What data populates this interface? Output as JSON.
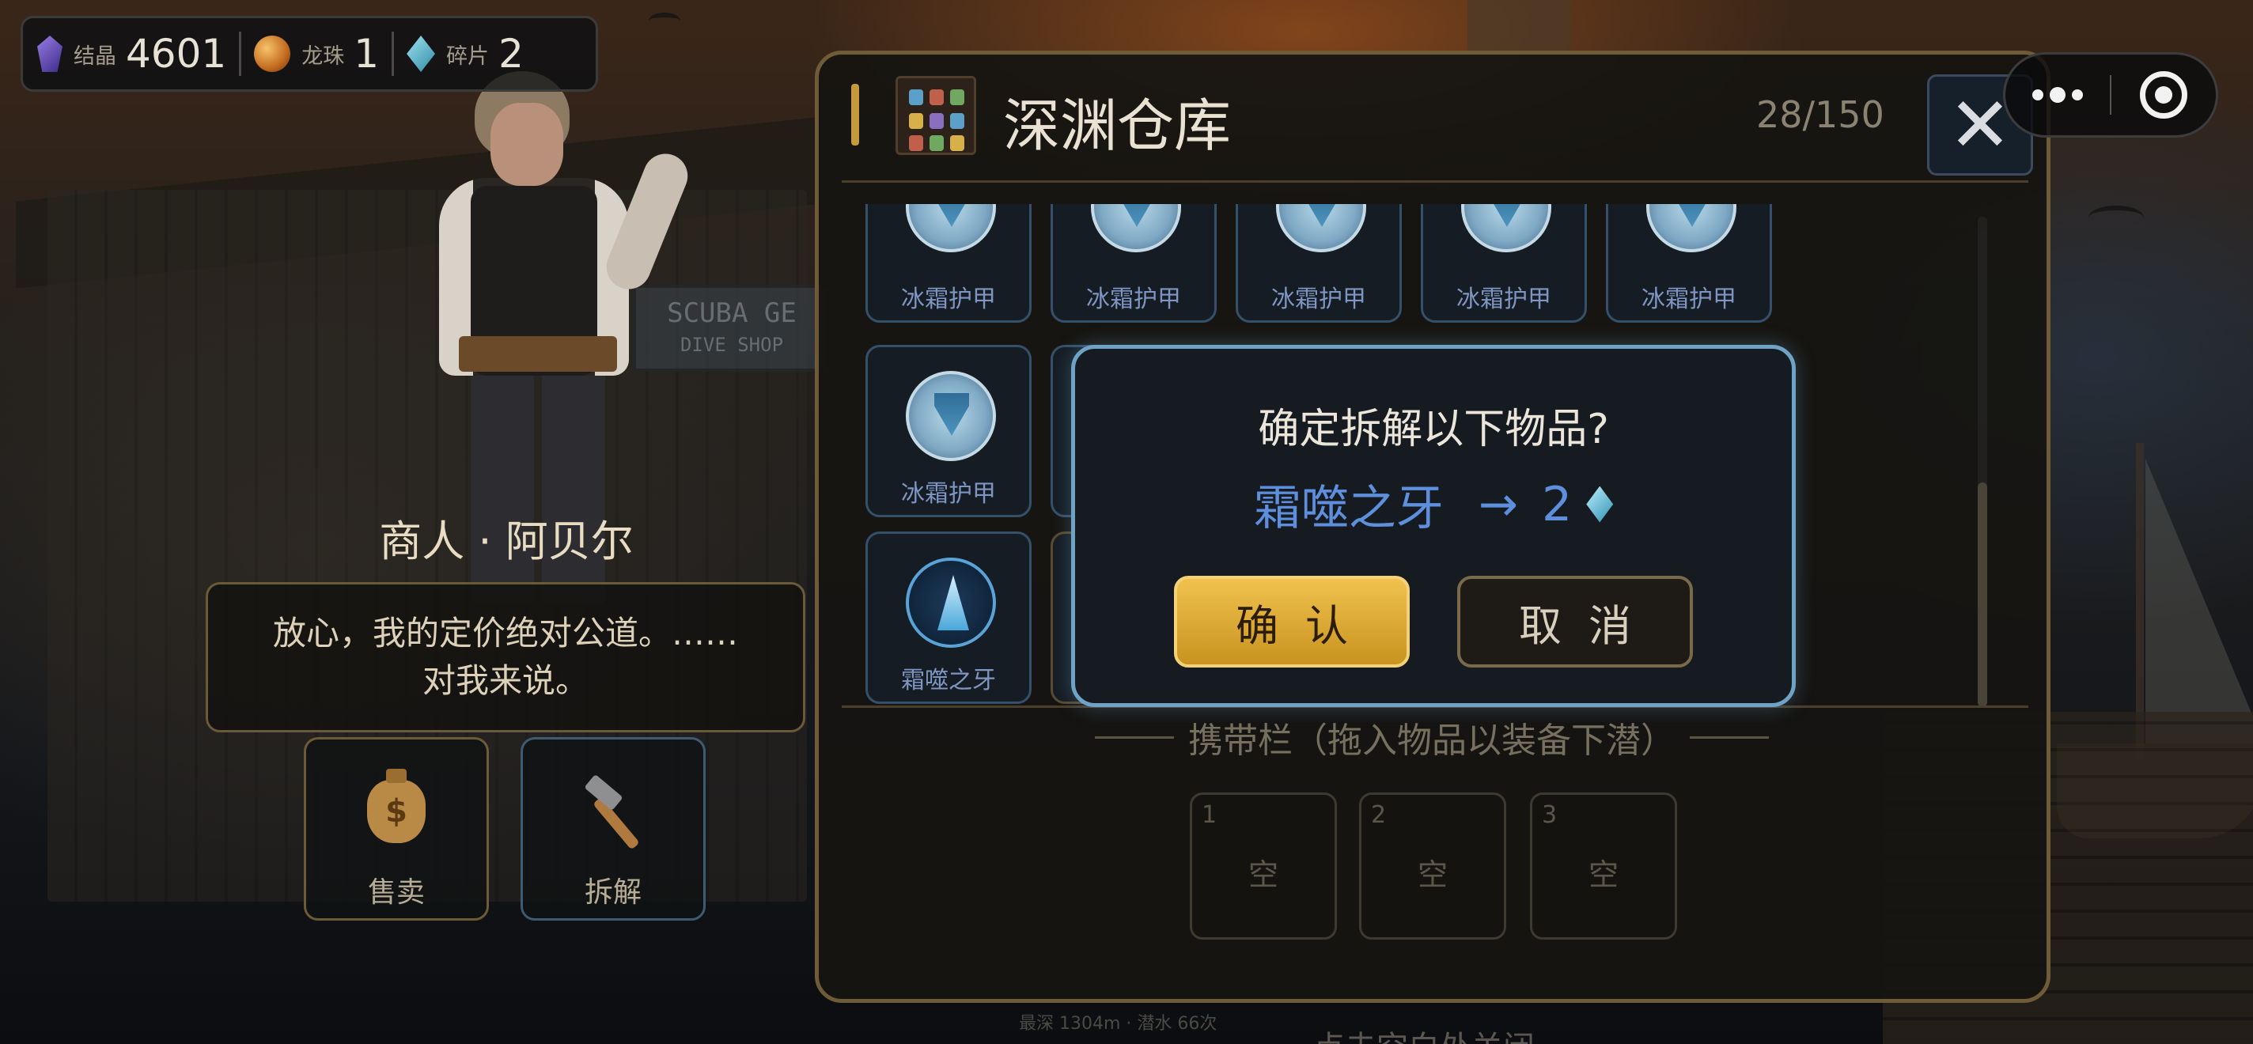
{
  "resources": [
    {
      "icon": "crystal-icon",
      "label": "结晶",
      "value": "4601"
    },
    {
      "icon": "dragon-orb-icon",
      "label": "龙珠",
      "value": "1"
    },
    {
      "icon": "shard-icon",
      "label": "碎片",
      "value": "2"
    }
  ],
  "merchant": {
    "name": "商人 · 阿贝尔",
    "dialog_line1": "放心，我的定价绝对公道。……",
    "dialog_line2": "对我来说。",
    "sell_label": "售卖",
    "dismantle_label": "拆解"
  },
  "backdrop": {
    "sign_line1": "SCUBA GE",
    "sign_line2": "DIVE SHOP"
  },
  "warehouse": {
    "title": "深渊仓库",
    "count": "28/150",
    "close_symbol": "✕",
    "items": [
      {
        "name": "冰霜护甲",
        "icon": "frost-armor-icon"
      },
      {
        "name": "冰霜护甲",
        "icon": "frost-armor-icon"
      },
      {
        "name": "冰霜护甲",
        "icon": "frost-armor-icon"
      },
      {
        "name": "冰霜护甲",
        "icon": "frost-armor-icon"
      },
      {
        "name": "冰霜护甲",
        "icon": "frost-armor-icon"
      },
      {
        "name": "冰霜护甲",
        "icon": "frost-armor-icon"
      },
      {
        "name": "霜噬之牙",
        "icon": "frost-fang-icon"
      }
    ]
  },
  "carry": {
    "title": "携带栏（拖入物品以装备下潜）",
    "slots": [
      {
        "num": "1",
        "label": "空"
      },
      {
        "num": "2",
        "label": "空"
      },
      {
        "num": "3",
        "label": "空"
      }
    ]
  },
  "confirm_dialog": {
    "title": "确定拆解以下物品?",
    "item_name": "霜噬之牙",
    "arrow": "→",
    "amount": "2",
    "confirm_label": "确认",
    "cancel_label": "取消"
  },
  "footer": {
    "stats": "最深 1304m · 潜水 66次",
    "hint": "点击空白处关闭"
  },
  "colors": {
    "accent_gold": "#c49a3c",
    "confirm_button": "#f0c24d",
    "item_text_blue": "#5d8fdd",
    "modal_border": "#6fa3c5"
  }
}
